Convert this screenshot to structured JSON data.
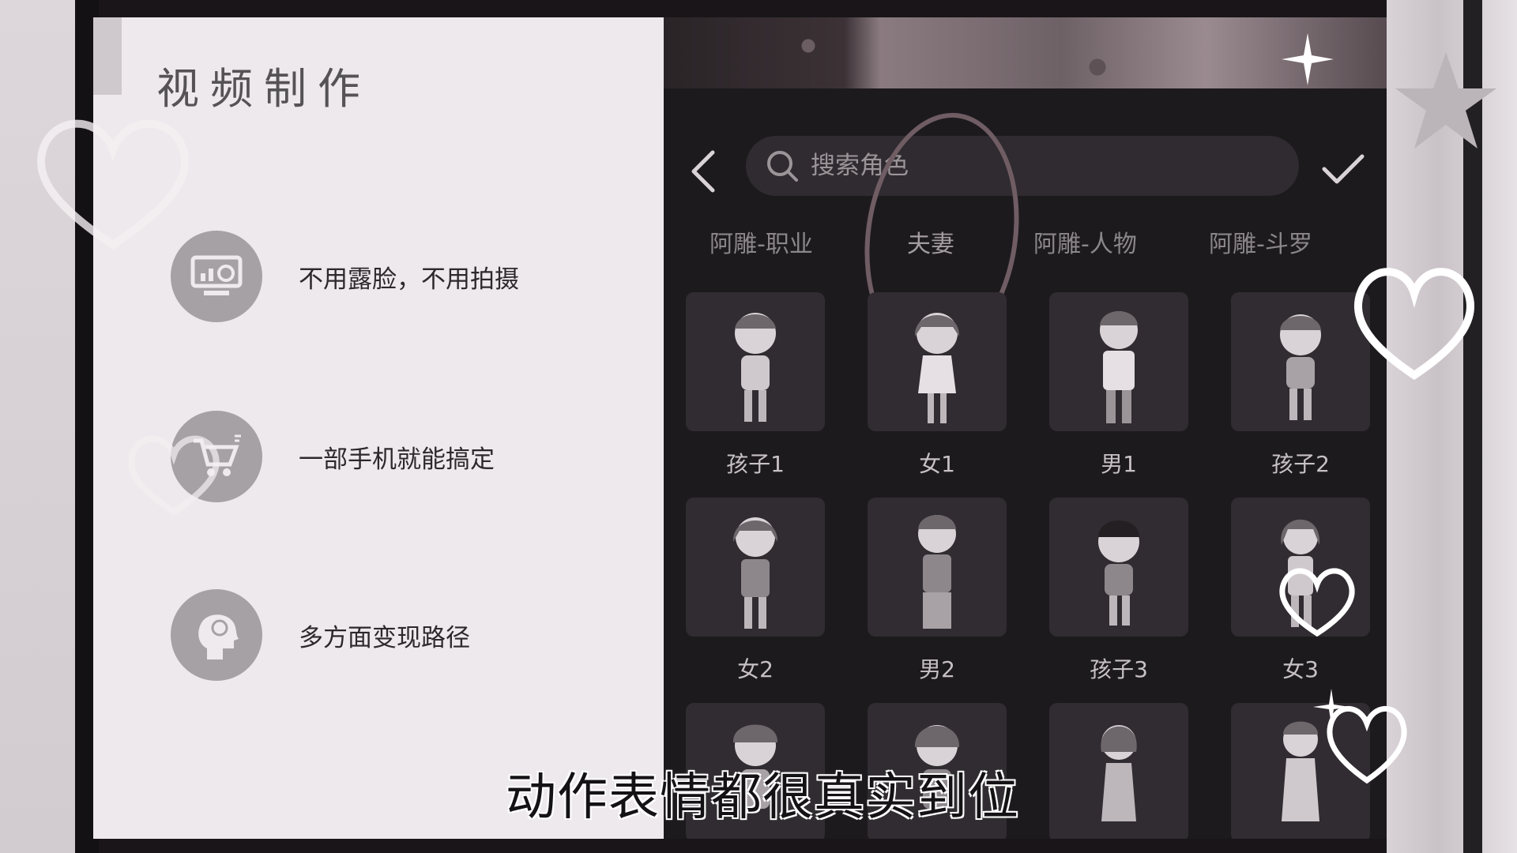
{
  "slide": {
    "title": "视频制作",
    "features": [
      {
        "text": "不用露脸，不用拍摄",
        "icon": "monitor-chart-icon"
      },
      {
        "text": "一部手机就能搞定",
        "icon": "shopping-cart-icon"
      },
      {
        "text": "多方面变现路径",
        "icon": "head-idea-icon"
      }
    ]
  },
  "app": {
    "search": {
      "placeholder": "搜索角色"
    },
    "tabs": [
      {
        "label": "阿雕-职业"
      },
      {
        "label": "夫妻"
      },
      {
        "label": "阿雕-人物"
      },
      {
        "label": "阿雕-斗罗"
      }
    ],
    "active_tab": 1,
    "characters": [
      {
        "label": "孩子1"
      },
      {
        "label": "女1"
      },
      {
        "label": "男1"
      },
      {
        "label": "孩子2"
      },
      {
        "label": "女2"
      },
      {
        "label": "男2"
      },
      {
        "label": "孩子3"
      },
      {
        "label": "女3"
      },
      {
        "label": ""
      },
      {
        "label": ""
      },
      {
        "label": ""
      },
      {
        "label": ""
      }
    ]
  },
  "subtitle": "动作表情都很真实到位",
  "colors": {
    "app_bg": "#1d1a1e",
    "slide_bg": "#eee9ec",
    "accent_oval": "#6f5d63"
  }
}
